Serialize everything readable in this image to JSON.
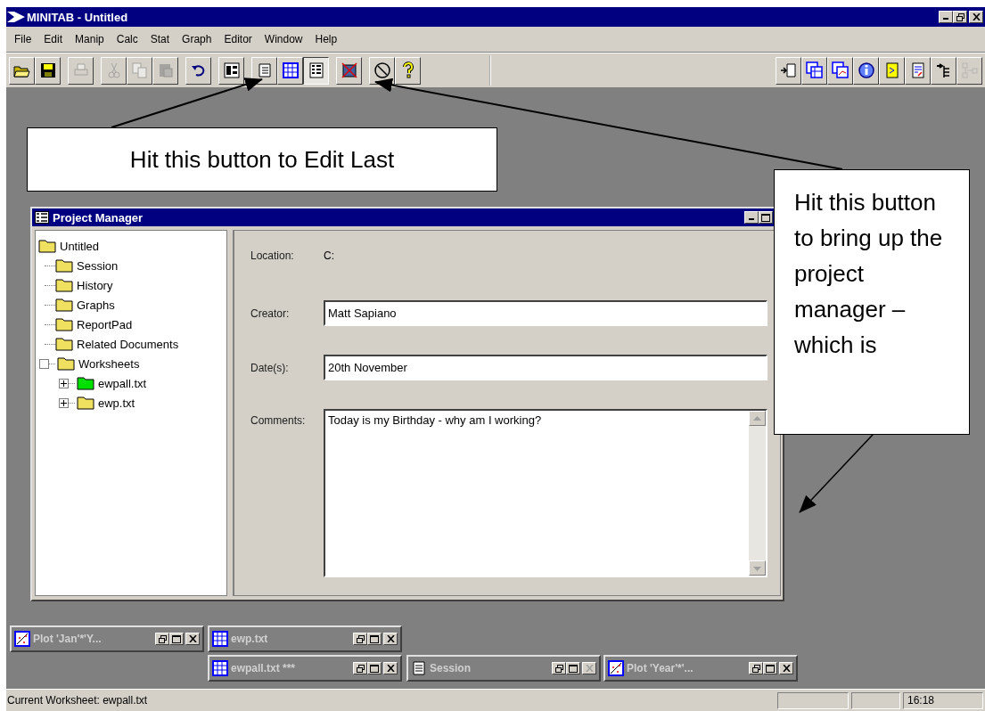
{
  "window": {
    "title": "MINITAB - Untitled"
  },
  "menu": [
    "File",
    "Edit",
    "Manip",
    "Calc",
    "Stat",
    "Graph",
    "Editor",
    "Window",
    "Help"
  ],
  "toolbar_left": [
    [
      {
        "kind": "open",
        "disabled": false,
        "pressed": false
      },
      {
        "kind": "save",
        "disabled": false,
        "pressed": false
      }
    ],
    [
      {
        "kind": "print",
        "disabled": true,
        "pressed": false
      }
    ],
    [
      {
        "kind": "cut",
        "disabled": true,
        "pressed": false
      },
      {
        "kind": "copy",
        "disabled": true,
        "pressed": false
      },
      {
        "kind": "paste",
        "disabled": true,
        "pressed": false
      }
    ],
    [
      {
        "kind": "undo",
        "disabled": false,
        "pressed": false
      }
    ],
    [
      {
        "kind": "edit-last",
        "disabled": false,
        "pressed": false
      }
    ],
    [
      {
        "kind": "session",
        "disabled": false,
        "pressed": false
      },
      {
        "kind": "worksheet",
        "disabled": false,
        "pressed": false
      },
      {
        "kind": "project-manager",
        "disabled": false,
        "pressed": true
      }
    ],
    [
      {
        "kind": "close-graphs",
        "disabled": false,
        "pressed": false
      }
    ],
    [
      {
        "kind": "cancel",
        "disabled": false,
        "pressed": false
      },
      {
        "kind": "help",
        "disabled": false,
        "pressed": false
      }
    ]
  ],
  "toolbar_right": [
    {
      "kind": "execute",
      "disabled": false
    },
    {
      "kind": "worksheets",
      "disabled": false
    },
    {
      "kind": "graphs",
      "disabled": false
    },
    {
      "kind": "info",
      "disabled": false
    },
    {
      "kind": "reportpad",
      "disabled": false
    },
    {
      "kind": "report",
      "disabled": false
    },
    {
      "kind": "insert",
      "disabled": false
    },
    {
      "kind": "tree",
      "disabled": true
    }
  ],
  "project_manager": {
    "title": "Project Manager",
    "tree": [
      {
        "label": "Untitled",
        "children": [
          {
            "label": "Session"
          },
          {
            "label": "History"
          },
          {
            "label": "Graphs"
          },
          {
            "label": "ReportPad"
          },
          {
            "label": "Related Documents"
          },
          {
            "label": "Worksheets",
            "expanded": true,
            "children": [
              {
                "label": "ewpall.txt",
                "expanded": false,
                "current": true
              },
              {
                "label": "ewp.txt",
                "expanded": false,
                "current": false
              }
            ]
          }
        ]
      }
    ],
    "location": {
      "label": "Location:",
      "value": "C:"
    },
    "creator": {
      "label": "Creator:",
      "value": "Matt Sapiano"
    },
    "dates": {
      "label": "Date(s):",
      "value": "20th November"
    },
    "comments": {
      "label": "Comments:",
      "value": "Today is my Birthday - why am I working?"
    }
  },
  "minimized_windows": [
    {
      "kind": "plot",
      "title": "Plot 'Jan'*'Y...",
      "close_disabled": false
    },
    {
      "kind": "worksheet",
      "title": "ewp.txt",
      "close_disabled": false
    },
    {
      "kind": "worksheet",
      "title": "ewpall.txt ***",
      "close_disabled": false
    },
    {
      "kind": "session",
      "title": "Session",
      "close_disabled": true
    },
    {
      "kind": "plot",
      "title": "Plot 'Year'*'...",
      "close_disabled": false
    }
  ],
  "status_bar": {
    "text": "Current Worksheet: ewpall.txt",
    "time": "16:18"
  },
  "callouts": [
    {
      "text": "Hit this button to Edit Last"
    },
    {
      "text": "Hit this button to bring up the project manager – which is"
    }
  ]
}
